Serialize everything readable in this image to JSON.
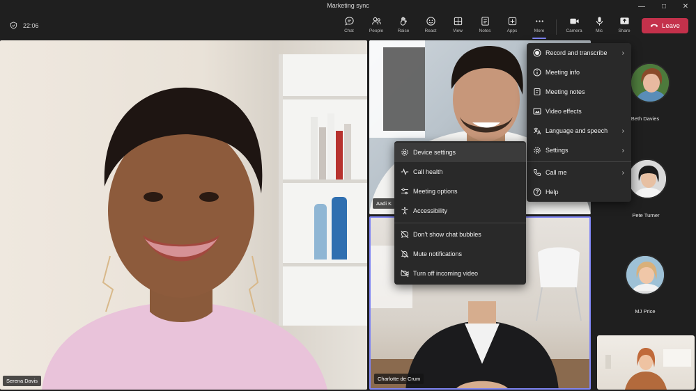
{
  "window": {
    "title": "Marketing sync"
  },
  "toolbar": {
    "timer": "22:06",
    "buttons": [
      {
        "label": "Chat",
        "icon": "chat-icon"
      },
      {
        "label": "People",
        "icon": "people-icon"
      },
      {
        "label": "Raise",
        "icon": "raise-hand-icon"
      },
      {
        "label": "React",
        "icon": "react-icon"
      },
      {
        "label": "View",
        "icon": "view-icon"
      },
      {
        "label": "Notes",
        "icon": "notes-icon"
      },
      {
        "label": "Apps",
        "icon": "apps-icon"
      },
      {
        "label": "More",
        "icon": "more-icon"
      },
      {
        "label": "Camera",
        "icon": "camera-icon"
      },
      {
        "label": "Mic",
        "icon": "mic-icon"
      },
      {
        "label": "Share",
        "icon": "share-icon"
      }
    ],
    "leave_label": "Leave"
  },
  "participants": {
    "main": "Serena Davis",
    "top_right": "Aadi K",
    "bottom_right": "Charlotte de Crum",
    "side": [
      "Beth Davies",
      "Pete Turner",
      "MJ Price"
    ]
  },
  "more_menu": {
    "items": [
      {
        "label": "Record and transcribe",
        "icon": "record-icon",
        "submenu": true
      },
      {
        "label": "Meeting info",
        "icon": "info-icon",
        "submenu": false
      },
      {
        "label": "Meeting notes",
        "icon": "notes-icon",
        "submenu": false
      },
      {
        "label": "Video effects",
        "icon": "video-effects-icon",
        "submenu": false
      },
      {
        "label": "Language and speech",
        "icon": "language-icon",
        "submenu": true
      },
      {
        "label": "Settings",
        "icon": "settings-icon",
        "submenu": true
      },
      {
        "label": "Call me",
        "icon": "phone-icon",
        "submenu": true
      },
      {
        "label": "Help",
        "icon": "help-icon",
        "submenu": false
      }
    ]
  },
  "settings_menu": {
    "items": [
      {
        "label": "Device settings",
        "icon": "device-settings-icon"
      },
      {
        "label": "Call health",
        "icon": "call-health-icon"
      },
      {
        "label": "Meeting options",
        "icon": "meeting-options-icon"
      },
      {
        "label": "Accessibility",
        "icon": "accessibility-icon"
      },
      {
        "label": "Don't show chat bubbles",
        "icon": "chat-bubble-off-icon"
      },
      {
        "label": "Mute notifications",
        "icon": "mute-notifications-icon"
      },
      {
        "label": "Turn off incoming video",
        "icon": "video-off-icon"
      }
    ]
  },
  "colors": {
    "accent": "#7f85f5",
    "leave": "#c4314b",
    "background": "#1f1f1f",
    "menu": "#292929"
  }
}
